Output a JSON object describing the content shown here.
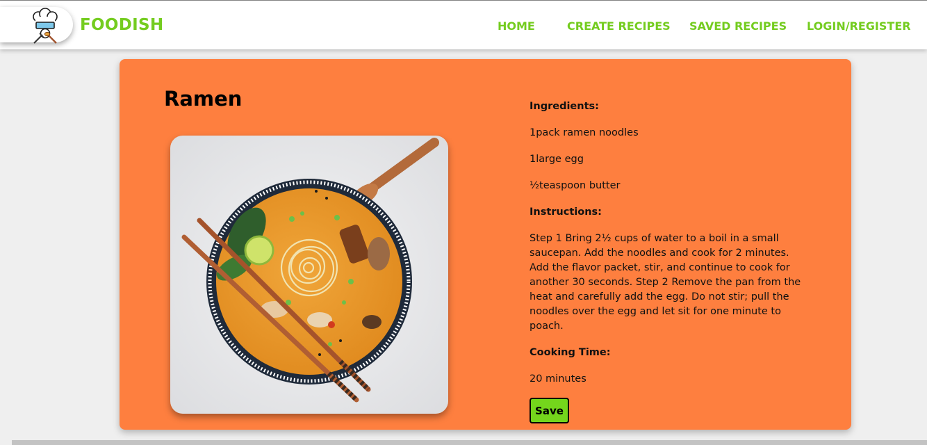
{
  "navbar": {
    "brand": "FOODISH",
    "links": [
      "HOME",
      "CREATE RECIPES",
      "SAVED RECIPES",
      "LOGIN/REGISTER"
    ]
  },
  "recipe": {
    "title": "Ramen",
    "image_alt": "Ramen",
    "ingredients_label": "Ingredients:",
    "ingredients": [
      "1pack ramen noodles",
      "1large egg",
      "½teaspoon butter"
    ],
    "instructions_label": "Instructions:",
    "instructions": "Step 1 Bring 2½ cups of water to a boil in a small saucepan. Add the noodles and cook for 2 minutes. Add the flavor packet, stir, and continue to cook for another 30 seconds. Step 2 Remove the pan from the heat and carefully add the egg. Do not stir; pull the noodles over the egg and let sit for one minute to poach.",
    "cooking_time_label": "Cooking Time:",
    "cooking_time": "20 minutes",
    "save_label": "Save"
  },
  "colors": {
    "accent": "#74cc1f",
    "card": "#fe7f3f",
    "save_button": "#74d61c",
    "background": "#efefef"
  },
  "icons": {
    "logo": "chef-hat-icon"
  }
}
